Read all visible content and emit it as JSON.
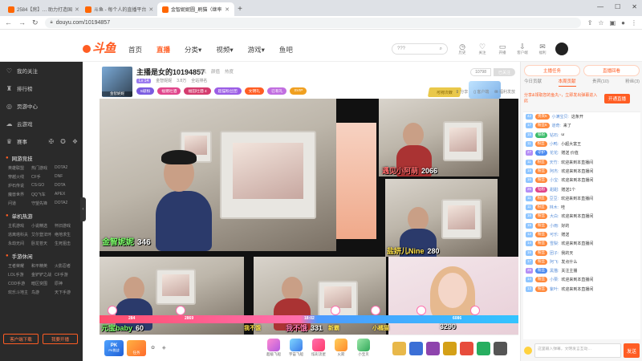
{
  "browser": {
    "tabs": [
      {
        "label": "2584【房】… 助力打造国",
        "active": false
      },
      {
        "label": "斗鱼 - 每个人的直播平台",
        "active": false
      },
      {
        "label": "金智妮妮圆_刷猫（继率",
        "active": true
      }
    ],
    "new_tab": "+",
    "url": "douyu.com/10194857"
  },
  "site": {
    "logo": "斗鱼",
    "nav": [
      "首页",
      "直播",
      "分类▾",
      "视频▾",
      "游戏▾",
      "鱼吧"
    ],
    "search_placeholder": "???",
    "header_icons": [
      {
        "label": "历史"
      },
      {
        "label": "关注"
      },
      {
        "label": "开播"
      },
      {
        "label": "客户端"
      },
      {
        "label": "福利"
      },
      {
        "label": "超市"
      }
    ]
  },
  "sidebar": {
    "items": [
      {
        "label": "我的关注"
      },
      {
        "label": "排行榜"
      },
      {
        "label": "页游中心"
      },
      {
        "label": "云游戏"
      },
      {
        "label": "赛事"
      }
    ],
    "sections": [
      {
        "title": "网游竞技",
        "games": [
          "英雄联盟",
          "热门游戏",
          "DOTA2",
          "穿越火线",
          "CF手",
          "DNF",
          "炉石传说",
          "CS:GO",
          "DOTA",
          "魔兽世界",
          "QQ飞车",
          "APEX",
          "问道",
          "守望先锋",
          "DOTA2"
        ]
      },
      {
        "title": "单机热游",
        "games": [
          "主机游戏",
          "小说精选",
          "怀旧游戏",
          "逃离塔科夫",
          "艾尔登法环",
          "绝地求生",
          "永劫无间",
          "卧龙苍天",
          "生死狙击"
        ]
      },
      {
        "title": "手游休闲",
        "games": [
          "王者荣耀",
          "和平精英",
          "火影忍者",
          "LOL手游",
          "金铲铲之战",
          "CF手游",
          "COD手游",
          "暗区突围",
          "原神",
          "欢乐斗地主",
          "鸟游",
          "天下手游"
        ]
      }
    ],
    "bottom_buttons": [
      "客户端下载",
      "我要开播"
    ]
  },
  "room": {
    "title": "主播是女的10194857",
    "category": [
      "单机",
      "颜值",
      "热度"
    ],
    "anchor_name": "金智妮妮",
    "level": "Lv 14",
    "fans": "3.8万",
    "rank": "全站排名",
    "tags": [
      {
        "text": "5级粉",
        "color": "#7a5be0"
      },
      {
        "text": "福猪吐酒",
        "color": "#e0458b"
      },
      {
        "text": "福田吐酒 4",
        "color": "#d43c6e"
      },
      {
        "text": "超猫粉丝团",
        "color": "#9b5de5"
      },
      {
        "text": "文明礼",
        "color": "#ff5d23"
      },
      {
        "text": "已有礼",
        "color": "#c16ee0"
      },
      {
        "text": "SVIP",
        "color": "#f0a020"
      }
    ],
    "game_banner": "可视次数",
    "follow_count": "10798",
    "follow_label": "已关注",
    "actions": [
      "分享",
      "客户端",
      "福利发放"
    ]
  },
  "video": {
    "cells": [
      {
        "name": "金智妮妮",
        "score": "346"
      },
      {
        "name": "遇见小阿萌",
        "score": "2066"
      },
      {
        "name": "盐妍儿Nine",
        "score": "280"
      },
      {
        "name": "元宝baby",
        "score": "60"
      },
      {
        "name": "我不饿",
        "score": "331"
      },
      {
        "name": "",
        "score": "3290"
      }
    ],
    "hud": [
      "284",
      "2869",
      "18:02",
      "6086"
    ],
    "hud_names": [
      "我不饿",
      "新霸",
      "小橘猫"
    ]
  },
  "giftbar": {
    "pk": "PK",
    "pk_sub": "PK挑战",
    "task": "任务",
    "gifts": [
      "超级飞船",
      "宇宙飞船",
      "炫彩流星",
      "火箭",
      "小宝贝",
      "鲸鱼"
    ]
  },
  "right_panel": {
    "top": [
      "主播任务",
      "直播回看"
    ],
    "tabs": [
      "今日贡献",
      "本周贡献",
      "贵宾(10)",
      "粉丝(3)"
    ],
    "sub_tabs": [
      "前三位",
      "贵宾(10)",
      "粉丝(3)"
    ],
    "notice": "分享&领取您的鱼丸~，立即发出弹幕进入此",
    "open_btn": "开通直播",
    "chat": [
      {
        "lv": "42",
        "fan": "贵宾5",
        "name": "小满宝贝:",
        "text": "这条开"
      },
      {
        "lv": "17",
        "fan": "粉丝6",
        "name": "道奇:",
        "text": "来了"
      },
      {
        "lv": "15",
        "fan": "铁粉",
        "name": "钻石:",
        "text": "ω"
      },
      {
        "lv": "11",
        "fan": "粉丝",
        "name": "小鸭:",
        "text": "小超大富王"
      },
      {
        "lv": "27",
        "fan": "守护",
        "name": "花花:",
        "text": "赠送 价值"
      },
      {
        "lv": "11",
        "fan": "粉丝",
        "name": "天竹:",
        "text": "欢迎来到本直播间"
      },
      {
        "lv": "18",
        "fan": "粉丝",
        "name": "阿杰:",
        "text": "欢迎来到本直播间"
      },
      {
        "lv": "16",
        "fan": "粉丝",
        "name": "小宝:",
        "text": "欢迎来到本直播间"
      },
      {
        "lv": "26",
        "fan": "钻粉",
        "name": "甜甜:",
        "text": "赠送1个"
      },
      {
        "lv": "11",
        "fan": "粉丝",
        "name": "豆豆:",
        "text": "欢迎来到本直播间"
      },
      {
        "lv": "11",
        "fan": "粉丝",
        "name": "林木:",
        "text": "哇"
      },
      {
        "lv": "16",
        "fan": "粉丝",
        "name": "大白:",
        "text": "欢迎来到本直播间"
      },
      {
        "lv": "15",
        "fan": "粉丝",
        "name": "小雨:",
        "text": "好的"
      },
      {
        "lv": "12",
        "fan": "粉丝",
        "name": "可乐:",
        "text": "赠送"
      },
      {
        "lv": "14",
        "fan": "粉丝",
        "name": "雪梨:",
        "text": "欢迎来到本直播间"
      },
      {
        "lv": "16",
        "fan": "粉丝",
        "name": "团子:",
        "text": "我的天"
      },
      {
        "lv": "17",
        "fan": "粉丝",
        "name": "阿飞:",
        "text": "发点什么"
      },
      {
        "lv": "28",
        "fan": "粉丝",
        "name": "黑猫:",
        "text": "关注主播"
      },
      {
        "lv": "14",
        "fan": "粉丝",
        "name": "小栗:",
        "text": "欢迎来到本直播间"
      },
      {
        "lv": "13",
        "fan": "粉丝",
        "name": "紫叶:",
        "text": "欢迎来到本直播间"
      }
    ],
    "input_placeholder": "这里输入弹幕，文明发言互动…",
    "send": "发送"
  }
}
